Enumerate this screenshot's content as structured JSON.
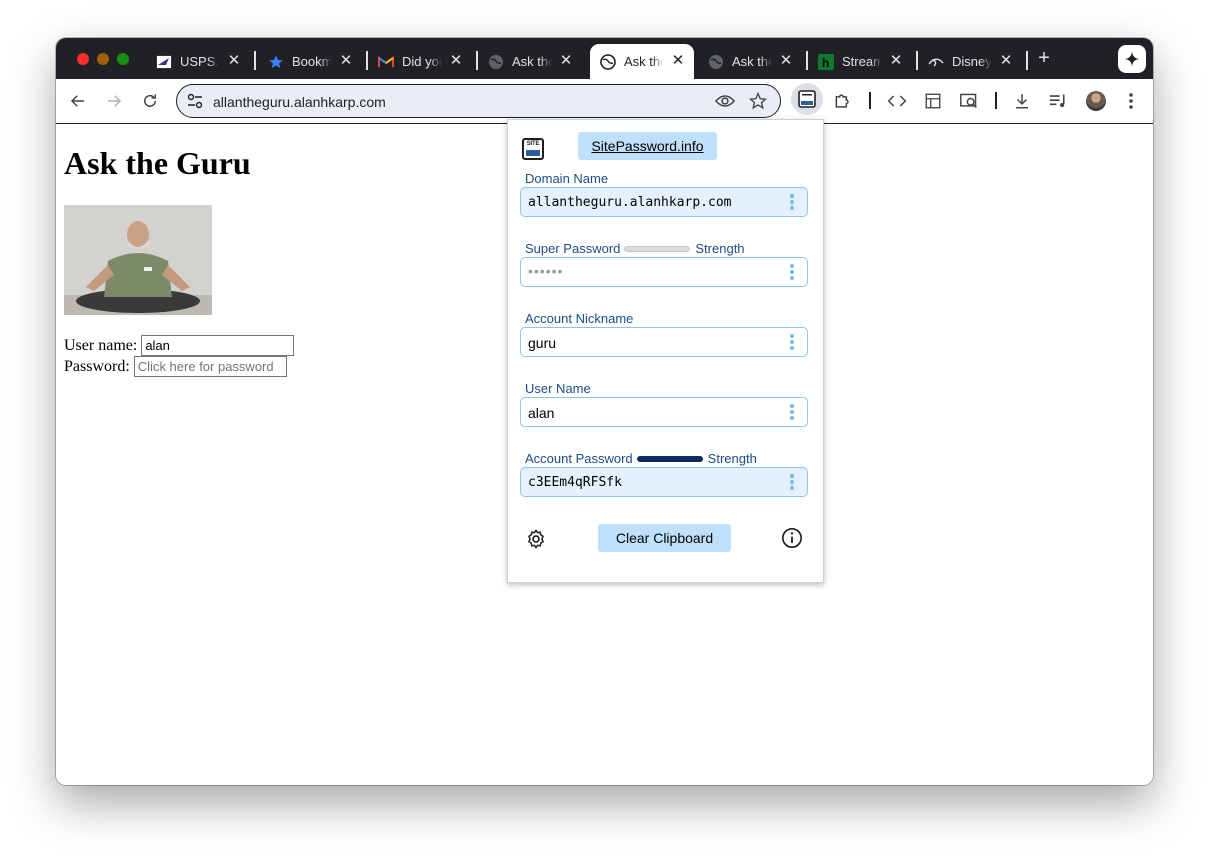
{
  "browser": {
    "tabs": [
      {
        "title": "USPS.com",
        "icon": "usps-eagle-icon"
      },
      {
        "title": "Bookmarks",
        "icon": "star-icon"
      },
      {
        "title": "Did you",
        "icon": "gmail-icon"
      },
      {
        "title": "Ask the Guru",
        "icon": "globe-icon"
      },
      {
        "title": "Ask the Guru",
        "icon": "globe-icon"
      },
      {
        "title": "Ask the Guru",
        "icon": "globe-icon"
      },
      {
        "title": "Stream",
        "icon": "hulu-icon"
      },
      {
        "title": "Disney+",
        "icon": "disney-icon"
      }
    ],
    "active_tab_index": 4,
    "address_bar": {
      "url": "allantheguru.alanhkarp.com"
    },
    "colors": {
      "tabstrip": "#202124",
      "omnibox": "#e9eef6"
    }
  },
  "page": {
    "heading": "Ask the Guru",
    "photo": "man-meditating-photo",
    "username_label": "User name:",
    "username_value": "alan",
    "password_label": "Password:",
    "password_placeholder": "Click here for password"
  },
  "popup": {
    "logo_text": "SITE",
    "header_link": "SitePassword.info",
    "domain_label": "Domain Name",
    "domain_value": "allantheguru.alanhkarp.com",
    "super_password_label": "Super Password",
    "super_password_strength_label": "Strength",
    "super_password_strength": 0.05,
    "super_password_value": "••••••",
    "nickname_label": "Account Nickname",
    "nickname_value": "guru",
    "username_label": "User Name",
    "username_value": "alan",
    "account_password_label": "Account Password",
    "account_password_strength_label": "Strength",
    "account_password_strength": 1.0,
    "account_password_value": "c3EEm4qRFSfk",
    "clear_button": "Clear Clipboard",
    "colors": {
      "label": "#1b4d86",
      "button": "#bfe0fb",
      "field_border": "#8cc6ef",
      "field_fill": "#e4f1fc",
      "strength_strong": "#0b2e5c"
    }
  }
}
